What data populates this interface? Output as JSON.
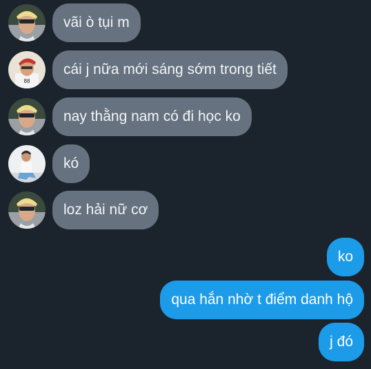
{
  "colors": {
    "background": "#1b232d",
    "incoming_bubble": "#66727f",
    "outgoing_bubble": "#1c9be9",
    "text": "#f2f5f8"
  },
  "messages": [
    {
      "direction": "incoming",
      "avatar": "avatar-blonde-glasses-icon",
      "text": "vãi ò tụi m"
    },
    {
      "direction": "incoming",
      "avatar": "avatar-red-hair-icon",
      "text": "cái j nữa mới sáng sớm trong tiết"
    },
    {
      "direction": "incoming",
      "avatar": "avatar-blonde-glasses-icon",
      "text": "nay thằng nam có đi học ko"
    },
    {
      "direction": "incoming",
      "avatar": "avatar-seated-person-icon",
      "text": "kó"
    },
    {
      "direction": "incoming",
      "avatar": "avatar-blonde-glasses-icon",
      "text": "loz hải nữ cơ"
    },
    {
      "direction": "outgoing",
      "text": "ko"
    },
    {
      "direction": "outgoing",
      "text": "qua hắn nhờ t điểm danh hộ"
    },
    {
      "direction": "outgoing",
      "text": "j đó"
    }
  ]
}
